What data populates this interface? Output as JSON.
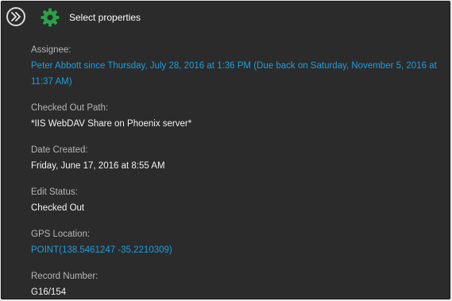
{
  "header": {
    "expand_icon": "double-chevron-right-icon",
    "settings_icon": "gear-icon",
    "title": "Select properties"
  },
  "colors": {
    "background": "#2b2b2b",
    "accent_green": "#2aa14a",
    "link_blue": "#1b9fe0",
    "label_gray": "#b5b5b5",
    "value_white": "#f2f2f2"
  },
  "properties": [
    {
      "label": "Assignee:",
      "value": "Peter Abbott since Thursday, July 28, 2016 at 1:36 PM (Due back on Saturday, November 5, 2016 at 11:37 AM)",
      "is_link": true
    },
    {
      "label": "Checked Out Path:",
      "value": "*IIS WebDAV Share on Phoenix server*",
      "is_link": false
    },
    {
      "label": "Date Created:",
      "value": "Friday, June 17, 2016 at 8:55 AM",
      "is_link": false
    },
    {
      "label": "Edit Status:",
      "value": "Checked Out",
      "is_link": false
    },
    {
      "label": "GPS Location:",
      "value": "POINT(138.5461247 -35.2210309)",
      "is_link": true
    },
    {
      "label": "Record Number:",
      "value": "G16/154",
      "is_link": false
    }
  ]
}
